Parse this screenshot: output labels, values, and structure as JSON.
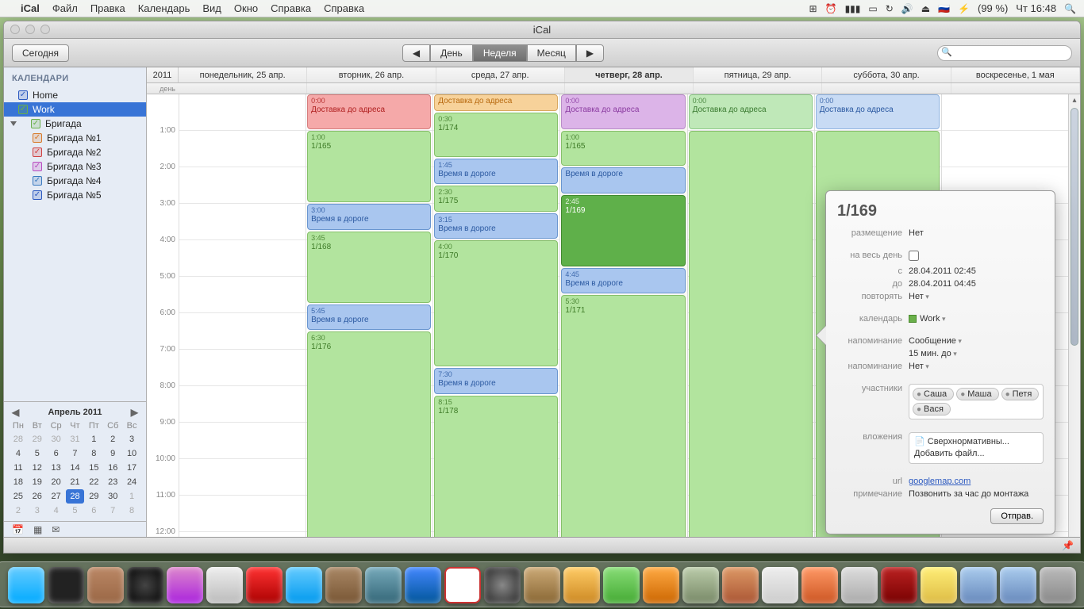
{
  "menubar": {
    "app": "iCal",
    "items": [
      "Файл",
      "Правка",
      "Календарь",
      "Вид",
      "Окно",
      "Справка",
      "Справка"
    ],
    "battery": "(99 %)",
    "clock": "Чт 16:48",
    "flag": "🇷🇺"
  },
  "window": {
    "title": "iCal",
    "today_btn": "Сегодня",
    "seg": {
      "prev": "◀",
      "day": "День",
      "week": "Неделя",
      "month": "Месяц",
      "next": "▶"
    },
    "search_placeholder": ""
  },
  "sidebar": {
    "head": "КАЛЕНДАРИ",
    "items": [
      {
        "label": "Home",
        "color": "#2a58c0"
      },
      {
        "label": "Work",
        "color": "#6ab04a",
        "selected": true
      },
      {
        "label": "Бригада",
        "color": "#6ab04a",
        "group": true
      },
      {
        "label": "Бригада №1",
        "color": "#d87a2a",
        "child": true
      },
      {
        "label": "Бригада №2",
        "color": "#d04040",
        "child": true
      },
      {
        "label": "Бригада №3",
        "color": "#b84ac0",
        "child": true
      },
      {
        "label": "Бригада №4",
        "color": "#3a7ac0",
        "child": true
      },
      {
        "label": "Бригада №5",
        "color": "#2a58c0",
        "child": true
      }
    ]
  },
  "mini": {
    "title": "Апрель 2011",
    "dow": [
      "Пн",
      "Вт",
      "Ср",
      "Чт",
      "Пт",
      "Сб",
      "Вс"
    ],
    "days": [
      {
        "n": "28",
        "dim": true
      },
      {
        "n": "29",
        "dim": true
      },
      {
        "n": "30",
        "dim": true
      },
      {
        "n": "31",
        "dim": true
      },
      {
        "n": "1"
      },
      {
        "n": "2"
      },
      {
        "n": "3"
      },
      {
        "n": "4"
      },
      {
        "n": "5"
      },
      {
        "n": "6"
      },
      {
        "n": "7"
      },
      {
        "n": "8"
      },
      {
        "n": "9"
      },
      {
        "n": "10"
      },
      {
        "n": "11"
      },
      {
        "n": "12"
      },
      {
        "n": "13"
      },
      {
        "n": "14"
      },
      {
        "n": "15"
      },
      {
        "n": "16"
      },
      {
        "n": "17"
      },
      {
        "n": "18"
      },
      {
        "n": "19"
      },
      {
        "n": "20"
      },
      {
        "n": "21"
      },
      {
        "n": "22"
      },
      {
        "n": "23"
      },
      {
        "n": "24"
      },
      {
        "n": "25"
      },
      {
        "n": "26"
      },
      {
        "n": "27"
      },
      {
        "n": "28",
        "today": true
      },
      {
        "n": "29"
      },
      {
        "n": "30"
      },
      {
        "n": "1",
        "dim": true
      },
      {
        "n": "2",
        "dim": true
      },
      {
        "n": "3",
        "dim": true
      },
      {
        "n": "4",
        "dim": true
      },
      {
        "n": "5",
        "dim": true
      },
      {
        "n": "6",
        "dim": true
      },
      {
        "n": "7",
        "dim": true
      },
      {
        "n": "8",
        "dim": true
      }
    ]
  },
  "grid": {
    "year": "2011",
    "allday_label": "день",
    "days": [
      "понедельник, 25 апр.",
      "вторник, 26 апр.",
      "среда, 27 апр.",
      "четверг, 28 апр.",
      "пятница, 29 апр.",
      "суббота, 30 апр.",
      "воскресенье, 1 мая"
    ],
    "today_index": 3,
    "hours": [
      "1:00",
      "2:00",
      "3:00",
      "4:00",
      "5:00",
      "6:00",
      "7:00",
      "8:00",
      "9:00",
      "10:00",
      "11:00",
      "12:00"
    ],
    "events": [
      {
        "day": 1,
        "start": 0,
        "dur": 1,
        "cls": "red",
        "time": "0:00",
        "title": "Доставка до адреса"
      },
      {
        "day": 2,
        "start": 0,
        "dur": 0.5,
        "cls": "orange",
        "time": "",
        "title": "Доставка до адреса"
      },
      {
        "day": 3,
        "start": 0,
        "dur": 1,
        "cls": "purple",
        "time": "0:00",
        "title": "Доставка до адреса"
      },
      {
        "day": 4,
        "start": 0,
        "dur": 1,
        "cls": "teal",
        "time": "0:00",
        "title": "Доставка до адреса"
      },
      {
        "day": 5,
        "start": 0,
        "dur": 1,
        "cls": "lblue",
        "time": "0:00",
        "title": "Доставка до адреса"
      },
      {
        "day": 2,
        "start": 0.5,
        "dur": 1.25,
        "cls": "green",
        "time": "0:30",
        "title": "1/174"
      },
      {
        "day": 1,
        "start": 1,
        "dur": 2,
        "cls": "green",
        "time": "1:00",
        "title": "1/165"
      },
      {
        "day": 3,
        "start": 1,
        "dur": 1,
        "cls": "green",
        "time": "1:00",
        "title": "1/165"
      },
      {
        "day": 2,
        "start": 1.75,
        "dur": 0.75,
        "cls": "blue",
        "time": "1:45",
        "title": "Время в дороге"
      },
      {
        "day": 3,
        "start": 2,
        "dur": 0.75,
        "cls": "blue",
        "time": "",
        "title": "Время в дороге"
      },
      {
        "day": 2,
        "start": 2.5,
        "dur": 0.75,
        "cls": "green",
        "time": "2:30",
        "title": "1/175"
      },
      {
        "day": 3,
        "start": 2.75,
        "dur": 2,
        "cls": "dgreen",
        "time": "2:45",
        "title": "1/169"
      },
      {
        "day": 1,
        "start": 3,
        "dur": 0.75,
        "cls": "blue",
        "time": "3:00",
        "title": "Время в дороге"
      },
      {
        "day": 2,
        "start": 3.25,
        "dur": 0.75,
        "cls": "blue",
        "time": "3:15",
        "title": "Время в дороге"
      },
      {
        "day": 1,
        "start": 3.75,
        "dur": 2,
        "cls": "green",
        "time": "3:45",
        "title": "1/168"
      },
      {
        "day": 2,
        "start": 4,
        "dur": 3.5,
        "cls": "green",
        "time": "4:00",
        "title": "1/170"
      },
      {
        "day": 3,
        "start": 4.75,
        "dur": 0.75,
        "cls": "blue",
        "time": "4:45",
        "title": "Время в дороге"
      },
      {
        "day": 3,
        "start": 5.5,
        "dur": 7,
        "cls": "green",
        "time": "5:30",
        "title": "1/171"
      },
      {
        "day": 1,
        "start": 5.75,
        "dur": 0.75,
        "cls": "blue",
        "time": "5:45",
        "title": "Время в дороге"
      },
      {
        "day": 1,
        "start": 6.5,
        "dur": 6,
        "cls": "green",
        "time": "6:30",
        "title": "1/176"
      },
      {
        "day": 2,
        "start": 7.5,
        "dur": 0.75,
        "cls": "blue",
        "time": "7:30",
        "title": "Время в дороге"
      },
      {
        "day": 2,
        "start": 8.25,
        "dur": 4.5,
        "cls": "green",
        "time": "8:15",
        "title": "1/178"
      },
      {
        "day": 4,
        "start": 1,
        "dur": 12,
        "cls": "green",
        "time": "",
        "title": ""
      },
      {
        "day": 5,
        "start": 1,
        "dur": 12,
        "cls": "green",
        "time": "",
        "title": ""
      }
    ]
  },
  "pop": {
    "title": "1/169",
    "rows": {
      "location_k": "размещение",
      "location_v": "Нет",
      "allday_k": "на весь день",
      "from_k": "с",
      "from_v": "28.04.2011 02:45",
      "to_k": "до",
      "to_v": "28.04.2011 04:45",
      "repeat_k": "повторять",
      "repeat_v": "Нет",
      "cal_k": "календарь",
      "cal_v": "Work",
      "alarm_k": "напоминание",
      "alarm_v": "Сообщение",
      "alarm_time": "15 мин. до",
      "alarm2_k": "напоминание",
      "alarm2_v": "Нет",
      "people_k": "участники",
      "attach_k": "вложения",
      "attach_file": "Сверхнормативны...",
      "attach_add": "Добавить файл...",
      "url_k": "url",
      "url_v": "googlemap.com",
      "note_k": "примечание",
      "note_v": "Позвонить за час до монтажа"
    },
    "people": [
      "Саша",
      "Маша",
      "Петя",
      "Вася"
    ],
    "send_btn": "Отправ."
  }
}
